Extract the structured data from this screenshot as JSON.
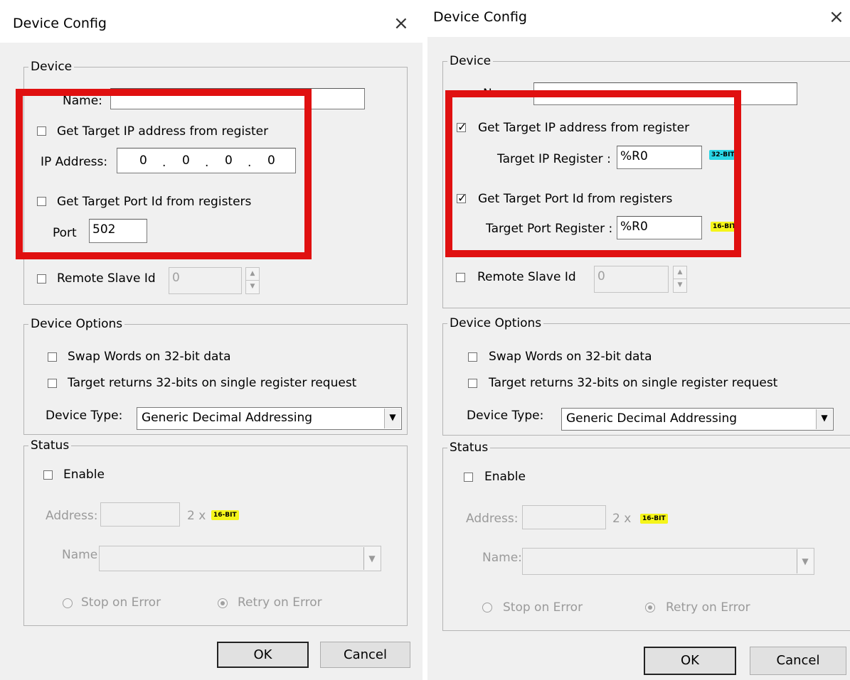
{
  "left": {
    "title": "Device Config",
    "close_glyph": "×",
    "device": {
      "legend": "Device",
      "name_label": "Name:",
      "ip_checkbox_label": "Get Target IP address from register",
      "ip_address_label": "IP Address:",
      "ip_octets": [
        "0",
        ".",
        "0",
        ".",
        "0",
        ".",
        "0"
      ],
      "port_checkbox_label": "Get Target Port Id from registers",
      "port_label": "Port",
      "port_value": "502",
      "remote_slave_label": "Remote Slave Id",
      "remote_slave_value": "0"
    },
    "options": {
      "legend": "Device Options",
      "swap_words_label": "Swap Words on 32-bit data",
      "target_returns_label": "Target returns 32-bits on single register request",
      "device_type_label": "Device Type:",
      "device_type_value": "Generic Decimal Addressing"
    },
    "status": {
      "legend": "Status",
      "enable_label": "Enable",
      "address_label": "Address:",
      "multiplier": "2 x",
      "badge": "16-BIT",
      "name_label": "Name:",
      "stop_on_error": "Stop on Error",
      "retry_on_error": "Retry on Error"
    },
    "ok_label": "OK",
    "cancel_label": "Cancel"
  },
  "right": {
    "title": "Device Config",
    "close_glyph": "×",
    "device": {
      "legend": "Device",
      "name_label": "Name:",
      "ip_checkbox_label": "Get Target IP address from register",
      "ip_register_label": "Target IP Register :",
      "ip_register_value": "%R0",
      "ip_badge": "32-BIT",
      "port_checkbox_label": "Get Target Port Id from registers",
      "port_register_label": "Target Port Register :",
      "port_register_value": "%R0",
      "port_badge": "16-BIT",
      "remote_slave_label": "Remote Slave Id",
      "remote_slave_value": "0"
    },
    "options": {
      "legend": "Device Options",
      "swap_words_label": "Swap Words on 32-bit data",
      "target_returns_label": "Target returns 32-bits on single register request",
      "device_type_label": "Device Type:",
      "device_type_value": "Generic Decimal Addressing"
    },
    "status": {
      "legend": "Status",
      "enable_label": "Enable",
      "address_label": "Address:",
      "multiplier": "2 x",
      "badge": "16-BIT",
      "name_label": "Name:",
      "stop_on_error": "Stop on Error",
      "retry_on_error": "Retry on Error"
    },
    "ok_label": "OK",
    "cancel_label": "Cancel"
  },
  "colors": {
    "highlight": "#e01010",
    "badge_16bit": "#f5f51a",
    "badge_32bit": "#2ad6e6",
    "dialog_bg": "#f0f0f0"
  },
  "icons": [
    "close-icon",
    "dropdown-arrow-icon",
    "spin-up-icon",
    "spin-down-icon",
    "checkmark-icon"
  ]
}
